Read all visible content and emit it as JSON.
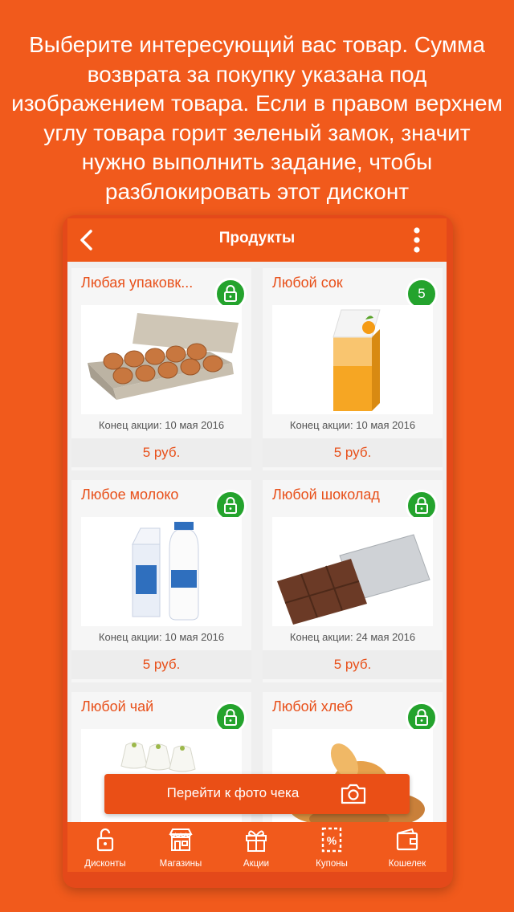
{
  "promo_text": "Выберите интересующий вас товар. Сумма возврата за покупку указана под изображением товара. Если в правом верхнем углу товара горит зеленый замок, значит нужно выполнить задание, чтобы разблокировать этот дисконт",
  "header": {
    "title": "Продукты"
  },
  "products": [
    {
      "name": "Любая упаковк...",
      "end_date": "Конец акции: 10 мая 2016",
      "price": "5 руб.",
      "status": "lock-icon"
    },
    {
      "name": "Любой сок",
      "end_date": "Конец акции: 10 мая 2016",
      "price": "5 руб.",
      "badge": "5"
    },
    {
      "name": "Любое молоко",
      "end_date": "Конец акции: 10 мая 2016",
      "price": "5 руб.",
      "status": "lock-icon"
    },
    {
      "name": "Любой шоколад",
      "end_date": "Конец акции: 24 мая 2016",
      "price": "5 руб.",
      "status": "lock-icon"
    },
    {
      "name": "Любой чай",
      "status": "lock-icon"
    },
    {
      "name": "Любой хлеб",
      "status": "lock-icon"
    }
  ],
  "cta": {
    "label": "Перейти к фото чека"
  },
  "tabs": [
    {
      "label": "Дисконты",
      "icon": "unlock-icon"
    },
    {
      "label": "Магазины",
      "icon": "store-icon"
    },
    {
      "label": "Акции",
      "icon": "gift-icon"
    },
    {
      "label": "Купоны",
      "icon": "coupon-icon"
    },
    {
      "label": "Кошелек",
      "icon": "wallet-icon"
    }
  ],
  "colors": {
    "brand": "#f15a1c",
    "accent_text": "#e8501a",
    "lock_green": "#24a32d"
  }
}
